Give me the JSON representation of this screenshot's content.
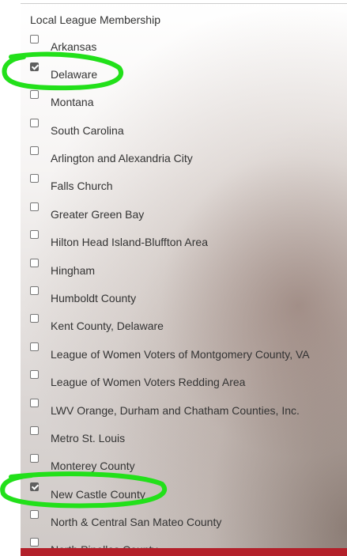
{
  "heading": "Local League Membership",
  "items": [
    {
      "label": "Arkansas",
      "checked": false
    },
    {
      "label": "Delaware",
      "checked": true
    },
    {
      "label": "Montana",
      "checked": false
    },
    {
      "label": "South Carolina",
      "checked": false
    },
    {
      "label": "Arlington and Alexandria City",
      "checked": false
    },
    {
      "label": "Falls Church",
      "checked": false
    },
    {
      "label": "Greater Green Bay",
      "checked": false
    },
    {
      "label": "Hilton Head Island-Bluffton Area",
      "checked": false
    },
    {
      "label": "Hingham",
      "checked": false
    },
    {
      "label": "Humboldt County",
      "checked": false
    },
    {
      "label": "Kent County, Delaware",
      "checked": false
    },
    {
      "label": "League of Women Voters of Montgomery County, VA",
      "checked": false
    },
    {
      "label": "League of Women Voters Redding Area",
      "checked": false
    },
    {
      "label": "LWV Orange, Durham and Chatham Counties, Inc.",
      "checked": false
    },
    {
      "label": "Metro St. Louis",
      "checked": false
    },
    {
      "label": "Monterey County",
      "checked": false
    },
    {
      "label": "New Castle County",
      "checked": true
    },
    {
      "label": "North & Central San Mateo County",
      "checked": false
    },
    {
      "label": "North Pinellas County",
      "checked": false
    }
  ],
  "colors": {
    "annotation": "#22e01a",
    "accent_bar": "#b3202a"
  }
}
